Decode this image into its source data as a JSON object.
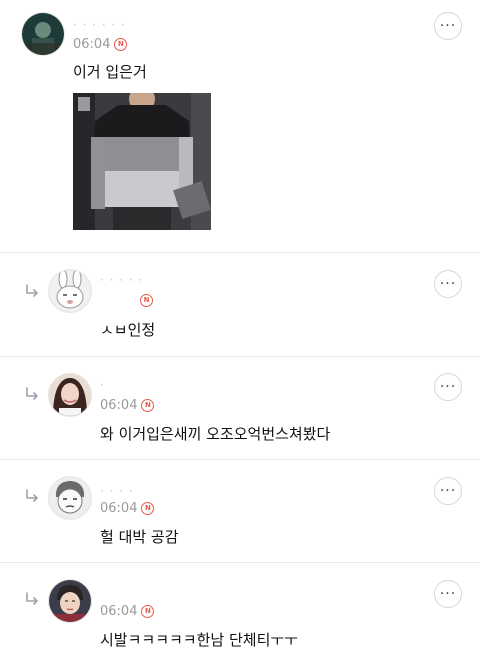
{
  "comments": [
    {
      "name": "· · · · · ·",
      "time": "06:04",
      "text": "이거 입은거",
      "has_photo": true
    },
    {
      "name": "· · · · ·",
      "time": "",
      "text": "ㅅㅂ인정",
      "reply": true
    },
    {
      "name": "·",
      "time": "06:04",
      "text": "와 이거입은새끼 오조오억번스쳐봤다",
      "reply": true
    },
    {
      "name": "· · · ·",
      "time": "06:04",
      "text": "헐 대박 공감",
      "reply": true
    },
    {
      "name": "",
      "time": "06:04",
      "text": "시발ㅋㅋㅋㅋㅋ한남 단체티ㅜㅜ",
      "reply": true
    }
  ],
  "badge_label": "N",
  "more_label": "···",
  "colors": {
    "badge": "#e8574b",
    "separator": "#e9e9e9",
    "time": "#9a9a9a"
  }
}
